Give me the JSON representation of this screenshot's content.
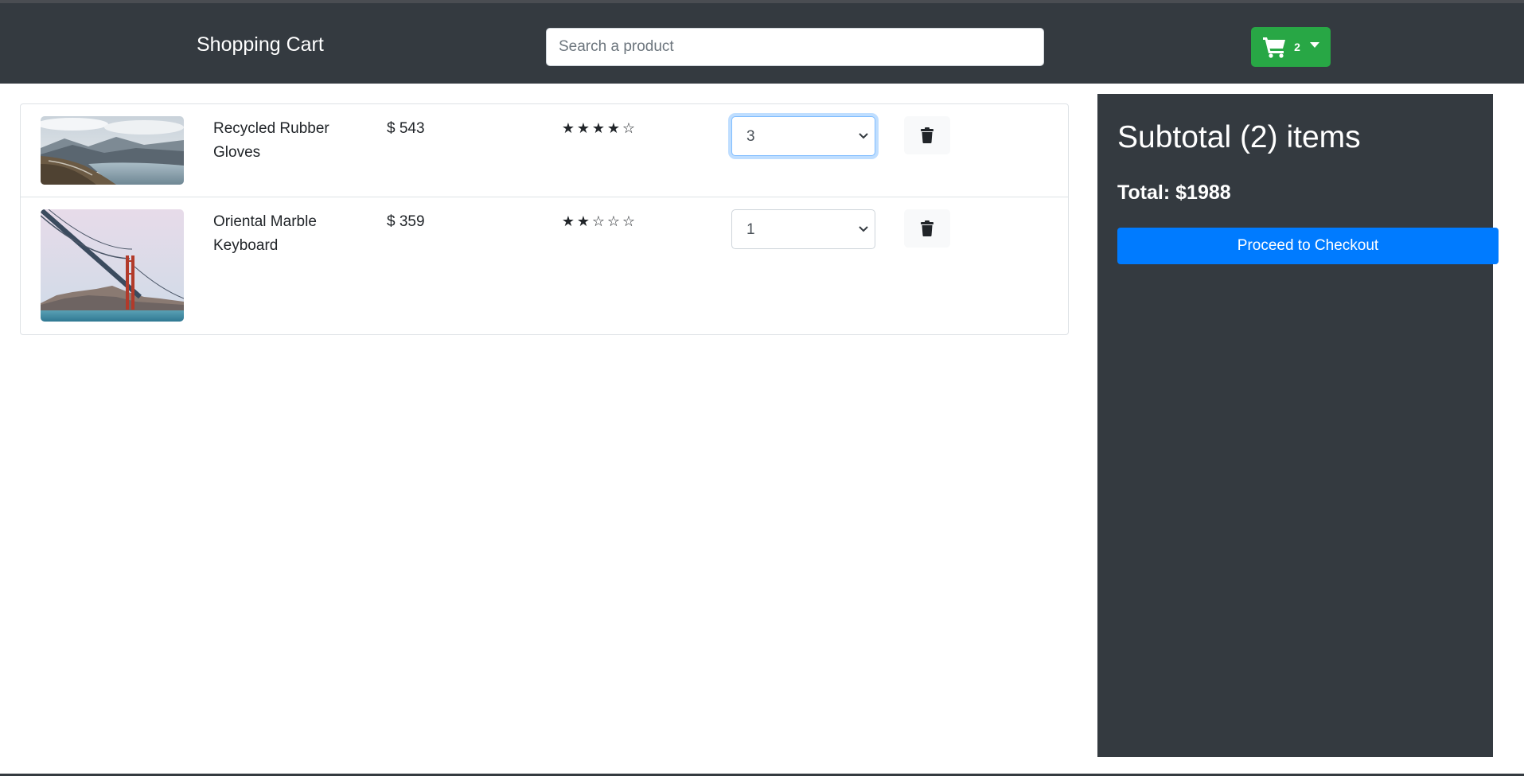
{
  "navbar": {
    "brand": "Shopping Cart",
    "search_placeholder": "Search a product",
    "cart_count": "2",
    "cart_icon": "cart-icon",
    "dropdown_icon": "caret-down-icon",
    "bg_color": "#343a40",
    "cart_button_color": "#28a745"
  },
  "cart": {
    "items": [
      {
        "name": "Recycled Rubber Gloves",
        "price": "$ 543",
        "rating": 4,
        "rating_max": 5,
        "quantity": "3",
        "image_icon": "mountain-lake-image",
        "delete_icon": "trash-icon"
      },
      {
        "name": "Oriental Marble Keyboard",
        "price": "$ 359",
        "rating": 2,
        "rating_max": 5,
        "quantity": "1",
        "image_icon": "golden-gate-bridge-image",
        "delete_icon": "trash-icon"
      }
    ]
  },
  "summary": {
    "title": "Subtotal (2) items",
    "total": "Total: $1988",
    "checkout_label": "Proceed to Checkout",
    "bg_color": "#343a40",
    "button_color": "#007bff"
  }
}
